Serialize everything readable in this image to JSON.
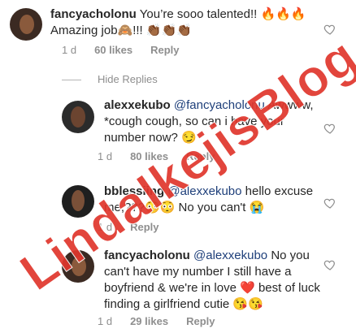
{
  "comments": [
    {
      "username": "fancyacholonu",
      "text_a": " You’re sooo talented!! 🔥🔥🔥",
      "text_b": "Amazing job🙈!!! 👏🏾👏🏾👏🏾",
      "time": "1 d",
      "likes": "60 likes",
      "reply": "Reply"
    },
    {
      "username": "alexxekubo",
      "mention": "@fancyacholonu",
      "text_a": " Awwww,",
      "text_b": "*cough cough, so can i have your",
      "text_c": "number now? 😏",
      "time": "1 d",
      "likes": "80 likes",
      "reply": "Reply"
    },
    {
      "username": "bblessiing",
      "mention": "@alexxekubo",
      "text_a": " hello excuse",
      "text_b": "me,???😳😳 No you can't 😭",
      "time": "1 d",
      "reply": "Reply"
    },
    {
      "username": "fancyacholonu",
      "mention": "@alexxekubo",
      "text_a": " No you",
      "text_b": "can't have my number I still have a",
      "text_c": "boyfriend & we're in love ❤️ best of luck",
      "text_d": "finding a girlfriend cutie 😘😘",
      "time": "1 d",
      "likes": "29 likes",
      "reply": "Reply"
    }
  ],
  "hide_replies": "Hide Replies",
  "watermark": "LindaIkejisBlog",
  "colors": {
    "mention": "#1e3f7a",
    "meta": "#8e8e8e",
    "watermark": "#e0362c"
  }
}
